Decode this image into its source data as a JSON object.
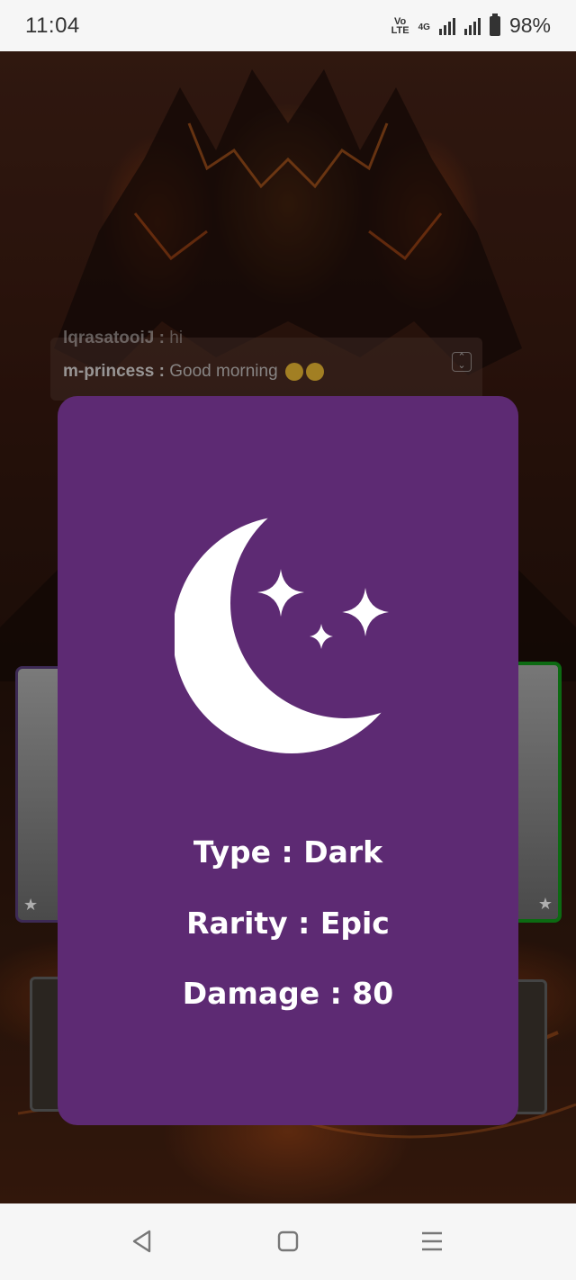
{
  "status_bar": {
    "time": "11:04",
    "volte_top": "Vo",
    "volte_bottom": "LTE",
    "network": "4G",
    "battery": "98%"
  },
  "chat": {
    "line1_user": "lqrasatooiJ :",
    "line1_text": "hi",
    "line2_user": "m-princess :",
    "line2_text": "Good morning"
  },
  "card": {
    "background_color": "#5d2a73",
    "icon": "crescent-moon-stars-icon",
    "type_text": "Type : Dark",
    "rarity_text": "Rarity : Epic",
    "damage_text": "Damage : 80"
  },
  "navigation": {
    "back_icon": "back-triangle-icon",
    "home_icon": "home-square-icon",
    "menu_icon": "menu-lines-icon"
  }
}
